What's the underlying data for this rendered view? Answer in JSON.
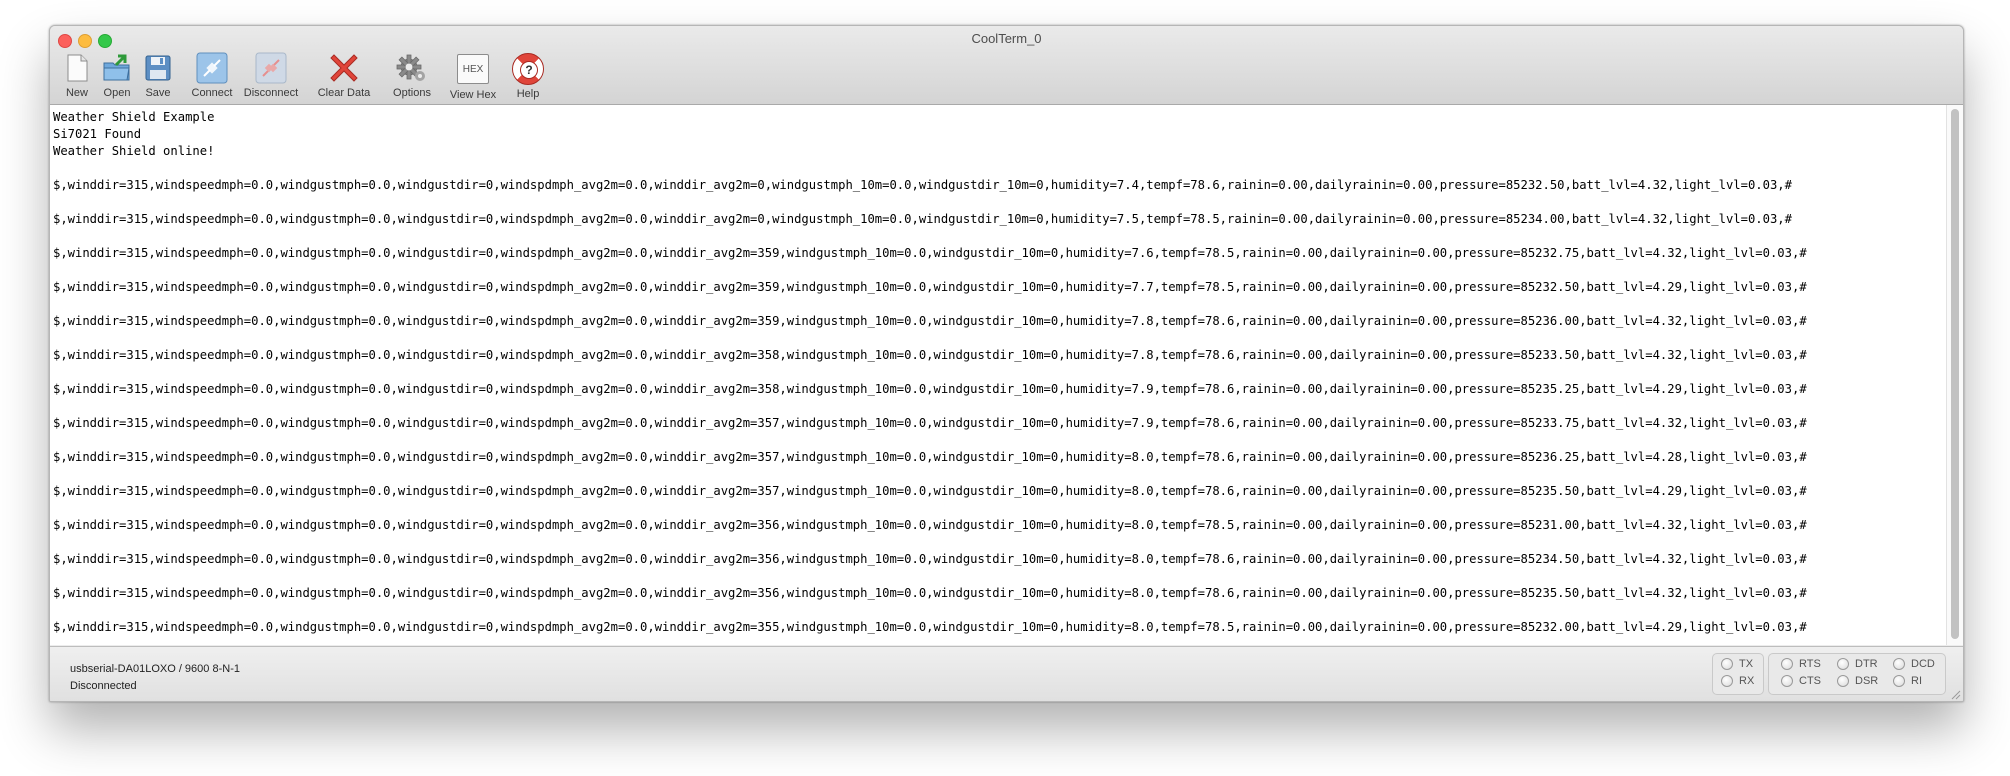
{
  "window": {
    "title": "CoolTerm_0"
  },
  "toolbar": {
    "buttons": [
      {
        "label": "New",
        "icon": "new-document-icon"
      },
      {
        "label": "Open",
        "icon": "open-folder-icon"
      },
      {
        "label": "Save",
        "icon": "save-floppy-icon"
      },
      {
        "label": "Connect",
        "icon": "connect-plug-icon"
      },
      {
        "label": "Disconnect",
        "icon": "disconnect-plug-icon"
      },
      {
        "label": "Clear Data",
        "icon": "clear-x-icon"
      },
      {
        "label": "Options",
        "icon": "gear-icon"
      },
      {
        "label": "View Hex",
        "icon": "hex-icon",
        "glyph": "HEX"
      },
      {
        "label": "Help",
        "icon": "lifebuoy-help-icon",
        "glyph": "?"
      }
    ]
  },
  "terminal": {
    "lines": [
      "Weather Shield Example",
      "Si7021 Found",
      "Weather Shield online!",
      "",
      "$,winddir=315,windspeedmph=0.0,windgustmph=0.0,windgustdir=0,windspdmph_avg2m=0.0,winddir_avg2m=0,windgustmph_10m=0.0,windgustdir_10m=0,humidity=7.4,tempf=78.6,rainin=0.00,dailyrainin=0.00,pressure=85232.50,batt_lvl=4.32,light_lvl=0.03,#",
      "",
      "$,winddir=315,windspeedmph=0.0,windgustmph=0.0,windgustdir=0,windspdmph_avg2m=0.0,winddir_avg2m=0,windgustmph_10m=0.0,windgustdir_10m=0,humidity=7.5,tempf=78.5,rainin=0.00,dailyrainin=0.00,pressure=85234.00,batt_lvl=4.32,light_lvl=0.03,#",
      "",
      "$,winddir=315,windspeedmph=0.0,windgustmph=0.0,windgustdir=0,windspdmph_avg2m=0.0,winddir_avg2m=359,windgustmph_10m=0.0,windgustdir_10m=0,humidity=7.6,tempf=78.5,rainin=0.00,dailyrainin=0.00,pressure=85232.75,batt_lvl=4.32,light_lvl=0.03,#",
      "",
      "$,winddir=315,windspeedmph=0.0,windgustmph=0.0,windgustdir=0,windspdmph_avg2m=0.0,winddir_avg2m=359,windgustmph_10m=0.0,windgustdir_10m=0,humidity=7.7,tempf=78.5,rainin=0.00,dailyrainin=0.00,pressure=85232.50,batt_lvl=4.29,light_lvl=0.03,#",
      "",
      "$,winddir=315,windspeedmph=0.0,windgustmph=0.0,windgustdir=0,windspdmph_avg2m=0.0,winddir_avg2m=359,windgustmph_10m=0.0,windgustdir_10m=0,humidity=7.8,tempf=78.6,rainin=0.00,dailyrainin=0.00,pressure=85236.00,batt_lvl=4.32,light_lvl=0.03,#",
      "",
      "$,winddir=315,windspeedmph=0.0,windgustmph=0.0,windgustdir=0,windspdmph_avg2m=0.0,winddir_avg2m=358,windgustmph_10m=0.0,windgustdir_10m=0,humidity=7.8,tempf=78.6,rainin=0.00,dailyrainin=0.00,pressure=85233.50,batt_lvl=4.32,light_lvl=0.03,#",
      "",
      "$,winddir=315,windspeedmph=0.0,windgustmph=0.0,windgustdir=0,windspdmph_avg2m=0.0,winddir_avg2m=358,windgustmph_10m=0.0,windgustdir_10m=0,humidity=7.9,tempf=78.6,rainin=0.00,dailyrainin=0.00,pressure=85235.25,batt_lvl=4.29,light_lvl=0.03,#",
      "",
      "$,winddir=315,windspeedmph=0.0,windgustmph=0.0,windgustdir=0,windspdmph_avg2m=0.0,winddir_avg2m=357,windgustmph_10m=0.0,windgustdir_10m=0,humidity=7.9,tempf=78.6,rainin=0.00,dailyrainin=0.00,pressure=85233.75,batt_lvl=4.32,light_lvl=0.03,#",
      "",
      "$,winddir=315,windspeedmph=0.0,windgustmph=0.0,windgustdir=0,windspdmph_avg2m=0.0,winddir_avg2m=357,windgustmph_10m=0.0,windgustdir_10m=0,humidity=8.0,tempf=78.6,rainin=0.00,dailyrainin=0.00,pressure=85236.25,batt_lvl=4.28,light_lvl=0.03,#",
      "",
      "$,winddir=315,windspeedmph=0.0,windgustmph=0.0,windgustdir=0,windspdmph_avg2m=0.0,winddir_avg2m=357,windgustmph_10m=0.0,windgustdir_10m=0,humidity=8.0,tempf=78.6,rainin=0.00,dailyrainin=0.00,pressure=85235.50,batt_lvl=4.29,light_lvl=0.03,#",
      "",
      "$,winddir=315,windspeedmph=0.0,windgustmph=0.0,windgustdir=0,windspdmph_avg2m=0.0,winddir_avg2m=356,windgustmph_10m=0.0,windgustdir_10m=0,humidity=8.0,tempf=78.5,rainin=0.00,dailyrainin=0.00,pressure=85231.00,batt_lvl=4.32,light_lvl=0.03,#",
      "",
      "$,winddir=315,windspeedmph=0.0,windgustmph=0.0,windgustdir=0,windspdmph_avg2m=0.0,winddir_avg2m=356,windgustmph_10m=0.0,windgustdir_10m=0,humidity=8.0,tempf=78.6,rainin=0.00,dailyrainin=0.00,pressure=85234.50,batt_lvl=4.32,light_lvl=0.03,#",
      "",
      "$,winddir=315,windspeedmph=0.0,windgustmph=0.0,windgustdir=0,windspdmph_avg2m=0.0,winddir_avg2m=356,windgustmph_10m=0.0,windgustdir_10m=0,humidity=8.0,tempf=78.6,rainin=0.00,dailyrainin=0.00,pressure=85235.50,batt_lvl=4.32,light_lvl=0.03,#",
      "",
      "$,winddir=315,windspeedmph=0.0,windgustmph=0.0,windgustdir=0,windspdmph_avg2m=0.0,winddir_avg2m=355,windgustmph_10m=0.0,windgustdir_10m=0,humidity=8.0,tempf=78.5,rainin=0.00,dailyrainin=0.00,pressure=85232.00,batt_lvl=4.29,light_lvl=0.03,#"
    ]
  },
  "status": {
    "port": "usbserial-DA01LOXO / 9600 8-N-1",
    "connection": "Disconnected",
    "indicators": {
      "tx": "TX",
      "rx": "RX",
      "rts": "RTS",
      "cts": "CTS",
      "dtr": "DTR",
      "dsr": "DSR",
      "dcd": "DCD",
      "ri": "RI"
    }
  }
}
